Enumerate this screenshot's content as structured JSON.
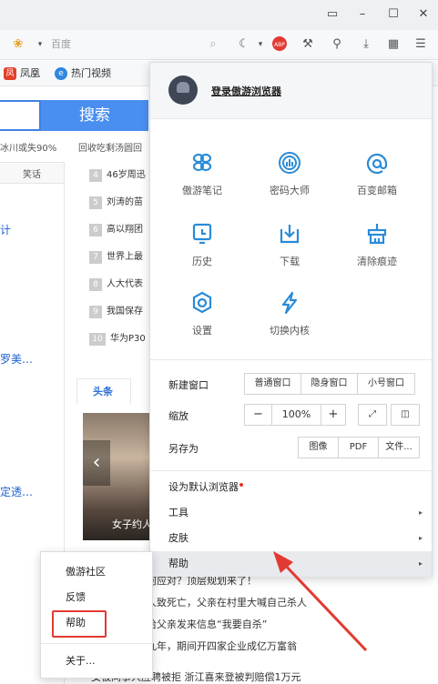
{
  "toolbar": {
    "address_text": "百度"
  },
  "bookmarks": [
    {
      "label": "凤凰",
      "icon": "phoenix-icon",
      "color": "#e2402a"
    },
    {
      "label": "热门视频",
      "icon": "video-icon",
      "color": "#2f87e0"
    }
  ],
  "page": {
    "search_button": "搜索",
    "hot_1": "冰川或失90%",
    "hot_2": "回收吃剩汤圆回",
    "tab_laugh": "笑话",
    "news": [
      {
        "num": "4",
        "text": "46岁周迅"
      },
      {
        "num": "5",
        "text": "刘涛的苗"
      },
      {
        "num": "6",
        "text": "高以翔团"
      },
      {
        "num": "7",
        "text": "世界上最"
      },
      {
        "num": "8",
        "text": "人大代表"
      },
      {
        "num": "9",
        "text": "我国保存"
      },
      {
        "num": "10",
        "text": "华为P30"
      }
    ],
    "left_link_1": "计",
    "left_link_2": "罗美…",
    "left_link_3": "定透…",
    "section_tab": "头条",
    "photo_caption": "女子约人",
    "stories": [
      "如何应对？顶层规划来了！",
      "伤人致死亡，父亲在村里大喊自己杀人",
      "发给父亲发来信息“我要自杀”",
      "逃九年，期间开四家企业成亿万富翁",
      "女被同事人应聘被拒  浙江喜来登被判赔偿1万元"
    ]
  },
  "menu": {
    "login": "登录傲游浏览器",
    "grid": [
      {
        "label": "傲游笔记",
        "icon": "notes-icon"
      },
      {
        "label": "密码大师",
        "icon": "fingerprint-icon"
      },
      {
        "label": "百变邮箱",
        "icon": "mail-at-icon"
      },
      {
        "label": "历史",
        "icon": "history-icon"
      },
      {
        "label": "下载",
        "icon": "download-icon"
      },
      {
        "label": "清除痕迹",
        "icon": "clear-traces-icon"
      },
      {
        "label": "设置",
        "icon": "settings-icon"
      },
      {
        "label": "切换内核",
        "icon": "lightning-icon"
      }
    ],
    "new_window": "新建窗口",
    "normal_window": "普通窗口",
    "incognito_window": "隐身窗口",
    "small_window": "小号窗口",
    "zoom": "缩放",
    "zoom_minus": "−",
    "zoom_value": "100%",
    "zoom_plus": "+",
    "save_as": "另存为",
    "save_image": "图像",
    "save_pdf": "PDF",
    "save_file": "文件...",
    "default_browser": "设为默认浏览器",
    "tools": "工具",
    "skin": "皮肤",
    "help": "帮助"
  },
  "submenu": {
    "community": "傲游社区",
    "feedback": "反馈",
    "help": "帮助",
    "about": "关于..."
  },
  "colors": {
    "accent": "#2a8bd6",
    "highlight": "#e23a32",
    "search": "#4a8ff0"
  }
}
